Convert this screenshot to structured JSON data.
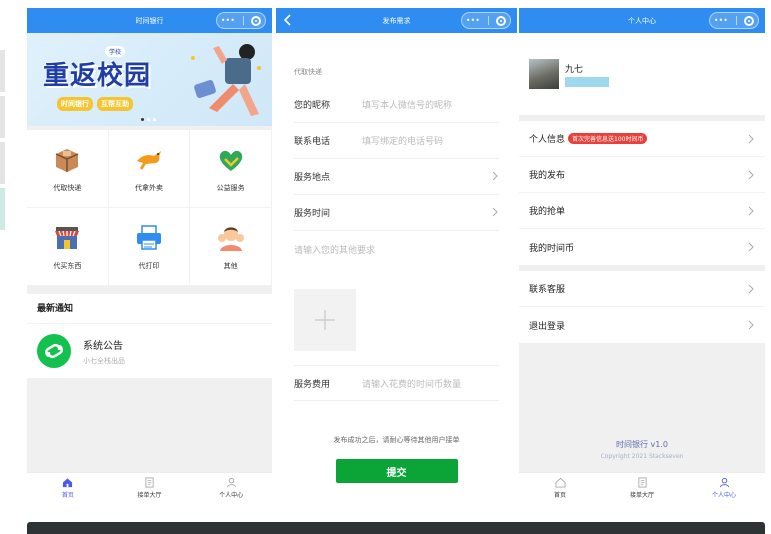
{
  "screen1": {
    "title": "时间银行",
    "banner": {
      "logo": "学校",
      "title": "重返校园",
      "tags": [
        "时间银行",
        "互帮互助"
      ]
    },
    "services": [
      {
        "label": "代取快递",
        "icon": "package-icon"
      },
      {
        "label": "代拿外卖",
        "icon": "kangaroo-delivery-icon"
      },
      {
        "label": "公益服务",
        "icon": "heart-hands-icon"
      },
      {
        "label": "代买东西",
        "icon": "store-icon"
      },
      {
        "label": "代打印",
        "icon": "printer-icon"
      },
      {
        "label": "其他",
        "icon": "people-icon"
      }
    ],
    "notice": {
      "header": "最新通知",
      "item_title": "系统公告",
      "item_sub": "小七全栈出品"
    },
    "tabs": [
      {
        "label": "首页",
        "icon": "home-icon",
        "active": true
      },
      {
        "label": "接单大厅",
        "icon": "document-icon",
        "active": false
      },
      {
        "label": "个人中心",
        "icon": "user-icon",
        "active": false
      }
    ]
  },
  "screen2": {
    "title": "发布需求",
    "section": "代取快递",
    "fields": [
      {
        "label": "您的昵称",
        "placeholder": "填写本人微信号的昵称",
        "arrow": false
      },
      {
        "label": "联系电话",
        "placeholder": "填写绑定的电话号码",
        "arrow": false
      },
      {
        "label": "服务地点",
        "placeholder": "",
        "arrow": true
      },
      {
        "label": "服务时间",
        "placeholder": "",
        "arrow": true
      }
    ],
    "request_placeholder": "请输入您的其他要求",
    "fee_label": "服务费用",
    "fee_placeholder": "请输入花费的时间币数量",
    "tip": "发布成功之后，请耐心等待其他用户接单",
    "submit": "提交"
  },
  "screen3": {
    "title": "个人中心",
    "username": "九七",
    "menu1": [
      {
        "label": "个人信息",
        "badge": "首次完善信息送100时间币"
      },
      {
        "label": "我的发布",
        "badge": ""
      },
      {
        "label": "我的抢单",
        "badge": ""
      },
      {
        "label": "我的时间币",
        "badge": ""
      }
    ],
    "menu2": [
      {
        "label": "联系客服"
      },
      {
        "label": "退出登录"
      }
    ],
    "version": "时间银行 v1.0",
    "copyright": "Copyright 2021 Stackseven",
    "tabs": [
      {
        "label": "首页",
        "icon": "home-icon",
        "active": false
      },
      {
        "label": "接单大厅",
        "icon": "document-icon",
        "active": false
      },
      {
        "label": "个人中心",
        "icon": "user-icon",
        "active": true
      }
    ]
  },
  "colors": {
    "navbar": "#2f8df2",
    "submit": "#0aa437",
    "badge": "#e8413b",
    "tab_active": "#4a5be6"
  }
}
